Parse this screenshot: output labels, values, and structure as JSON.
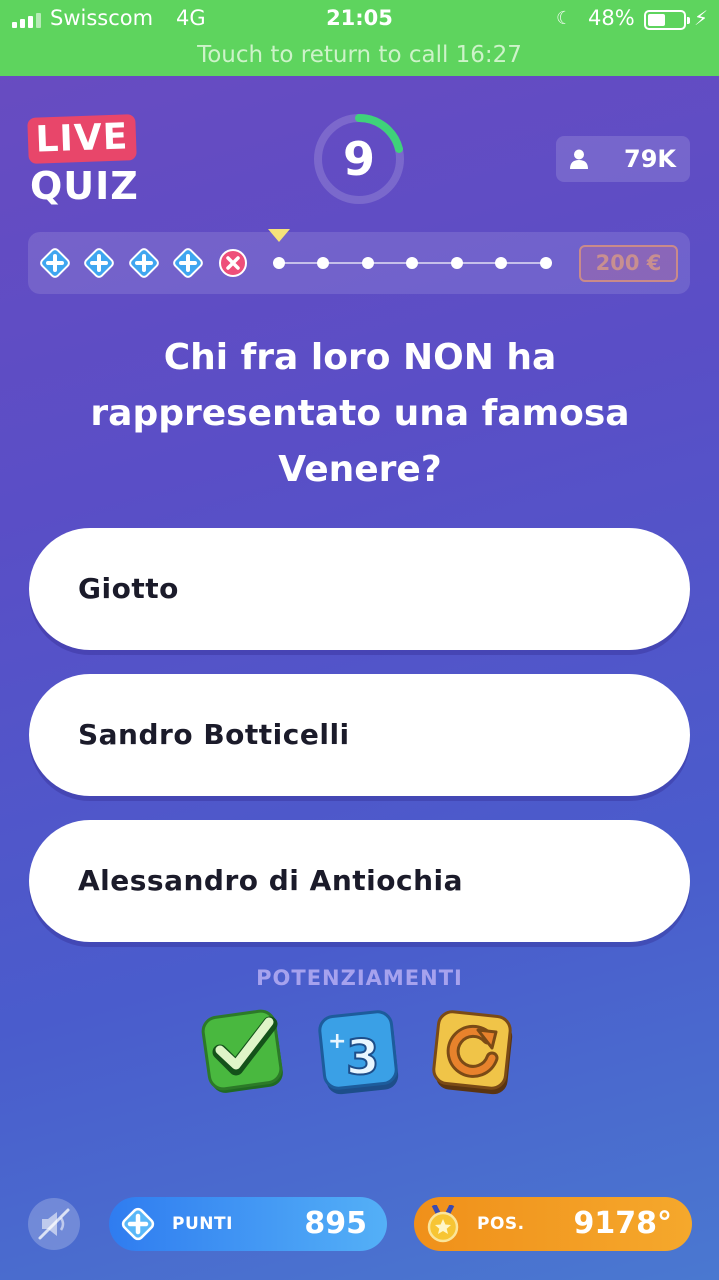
{
  "status_bar": {
    "carrier": "Swisscom",
    "network": "4G",
    "time": "21:05",
    "battery": "48%",
    "return_call": "Touch to return to call 16:27"
  },
  "header": {
    "logo_live": "LIVE",
    "logo_quiz": "QUIZ",
    "timer": "9",
    "viewers": "79K"
  },
  "progress": {
    "completed_steps": 4,
    "wrong_steps": 1,
    "remaining_steps": 7,
    "prize": "200 €"
  },
  "question": {
    "text": "Chi fra loro NON ha rappresentato una famosa Venere?"
  },
  "answers": [
    {
      "label": "Giotto"
    },
    {
      "label": "Sandro Botticelli"
    },
    {
      "label": "Alessandro di Antiochia"
    }
  ],
  "powerups": {
    "title": "POTENZIAMENTI",
    "items": [
      "checkmark-icon",
      "plus-three-icon",
      "refresh-icon"
    ]
  },
  "bottom_bar": {
    "points_label": "PUNTI",
    "points_value": "895",
    "position_label": "POS.",
    "position_value": "9178°"
  },
  "colors": {
    "status_bar": "#5ed45e",
    "live_badge": "#e8466a",
    "points_pill": "#3a8cf2",
    "position_pill": "#f29a22",
    "timer_arc": "#3fd27a"
  }
}
